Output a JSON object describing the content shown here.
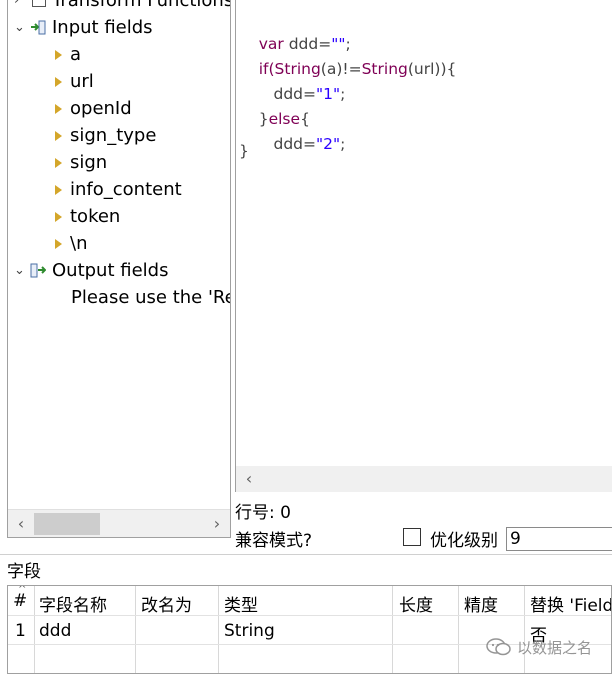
{
  "tree": {
    "transform_functions": "Transform Functions",
    "input_fields": {
      "label": "Input fields",
      "items": [
        "a",
        "url",
        "openId",
        "sign_type",
        "sign",
        "info_content",
        "token",
        "\\n"
      ]
    },
    "output_fields": {
      "label": "Output fields",
      "hint": "Please use the 'Rep"
    }
  },
  "code": {
    "line1": {
      "kw": "var",
      "rest": " ddd=",
      "str": "\"\"",
      "end": ";"
    },
    "line2": {
      "if": "if(",
      "s1": "String",
      "m1": "(a)!=",
      "s2": "String",
      "m2": "(url)){"
    },
    "line3": {
      "pre": "   ddd=",
      "str": "\"1\"",
      "end": ";"
    },
    "line4": {
      "brace": "}",
      "else": "else",
      "open": "{"
    },
    "line5": {
      "pre": "   ddd=",
      "str": "\"2\"",
      "end": ";"
    },
    "line6": "}"
  },
  "status": {
    "line_number": "行号: 0",
    "compat_mode": "兼容模式?",
    "opt_level_label": "优化级别",
    "opt_level_value": "9",
    "opt_checked": false
  },
  "fields": {
    "section_label": "字段",
    "columns": [
      "#",
      "字段名称",
      "改名为",
      "类型",
      "长度",
      "精度",
      "替换 'Field"
    ],
    "rows": [
      {
        "num": "1",
        "name": "ddd",
        "rename": "",
        "type": "String",
        "length": "",
        "precision": "",
        "replace": "否"
      }
    ]
  },
  "watermark": {
    "text": "以数据之名"
  },
  "colors": {
    "keyword": "#7f0055",
    "string": "#2a00ff",
    "tree_triangle": "#d4a62a"
  }
}
